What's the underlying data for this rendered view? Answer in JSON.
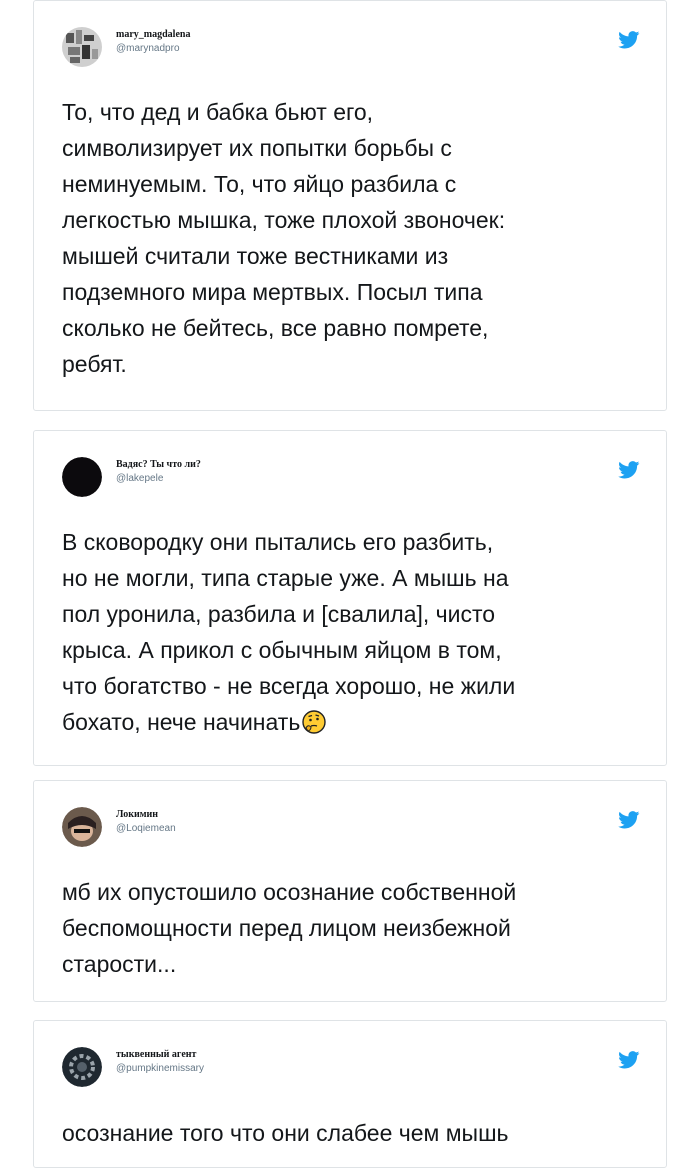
{
  "tweets": [
    {
      "display_name": "mary_magdalena",
      "handle": "@marynadpro",
      "text": "То, что дед и бабка бьют его,\nсимволизирует их попытки борьбы с\nнеминуемым. То, что яйцо разбила с\nлегкостью мышка, тоже плохой звоночек:\nмышей считали тоже вестниками из\nподземного мира мертвых. Посыл типа\nсколько не бейтесь, все равно помрете,\nребят.",
      "avatar_icon": "mosaic-avatar",
      "platform_icon": "twitter-bird-icon"
    },
    {
      "display_name": "Вадяс? Ты что ли?",
      "handle": "@lakepele",
      "text": "В сковородку они пытались его разбить,\nно не могли, типа старые уже. А мышь на\nпол уронила, разбила и [свалила], чисто\nкрыса. А прикол с обычным яйцом в том,\nчто богатство - не всегда хорошо, не жили\nбохато, нече начинать",
      "emoji": "thinking-face-emoji",
      "avatar_icon": "dark-circle-avatar",
      "platform_icon": "twitter-bird-icon"
    },
    {
      "display_name": "Локимин",
      "handle": "@Loqiemean",
      "text": "мб их опустошило осознание собственной\nбеспомощности перед лицом неизбежной\nстарости...",
      "avatar_icon": "photo-avatar",
      "platform_icon": "twitter-bird-icon"
    },
    {
      "display_name": "тыквенный агент",
      "handle": "@pumpkinemissary",
      "text": "осознание того что они слабее чем мышь",
      "avatar_icon": "gear-avatar",
      "platform_icon": "twitter-bird-icon"
    }
  ],
  "colors": {
    "twitter_blue": "#1da1f2",
    "text": "#14171a",
    "handle": "#657786",
    "border": "#dfe3e6"
  }
}
